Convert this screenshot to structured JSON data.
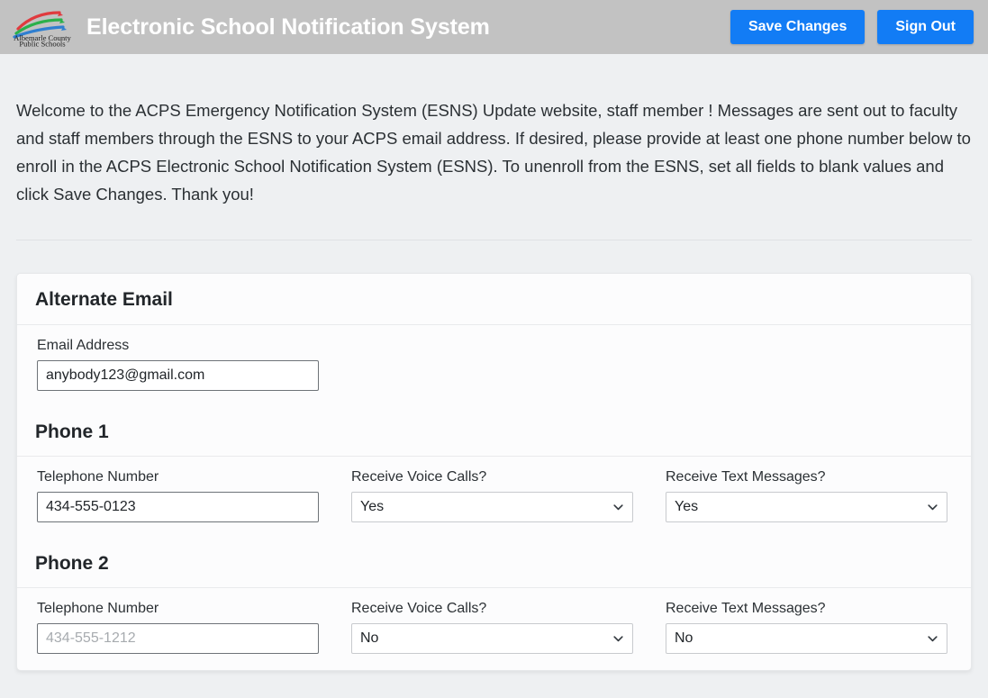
{
  "header": {
    "logo_alt": "Albemarle County Public Schools",
    "logo_line1": "Albemarle County",
    "logo_line2": "Public Schools",
    "title": "Electronic School Notification System",
    "save_label": "Save Changes",
    "signout_label": "Sign Out",
    "button_color": "#127cf5",
    "bar_color": "#c2c2c2"
  },
  "intro": {
    "text": "Welcome to the ACPS Emergency Notification System (ESNS) Update website,  staff member !  Messages are sent out to faculty and staff members through the ESNS to your ACPS email address. If desired, please provide at least one phone number below to enroll in the ACPS Electronic School Notification System (ESNS). To unenroll from the ESNS, set all fields to blank values and click Save Changes. Thank you!"
  },
  "email_section": {
    "heading": "Alternate Email",
    "email_label": "Email Address",
    "email_value": "anybody123@gmail.com",
    "email_placeholder": ""
  },
  "phone1": {
    "heading": "Phone 1",
    "telephone_label": "Telephone Number",
    "telephone_value": "434-555-0123",
    "telephone_placeholder": "434-555-1212",
    "voice_label": "Receive Voice Calls?",
    "voice_value": "Yes",
    "voice_options": [
      "Yes",
      "No"
    ],
    "text_label": "Receive Text Messages?",
    "text_value": "Yes",
    "text_options": [
      "Yes",
      "No"
    ]
  },
  "phone2": {
    "heading": "Phone 2",
    "telephone_label": "Telephone Number",
    "telephone_value": "",
    "telephone_placeholder": "434-555-1212",
    "voice_label": "Receive Voice Calls?",
    "voice_value": "No",
    "voice_options": [
      "Yes",
      "No"
    ],
    "text_label": "Receive Text Messages?",
    "text_value": "No",
    "text_options": [
      "Yes",
      "No"
    ]
  }
}
